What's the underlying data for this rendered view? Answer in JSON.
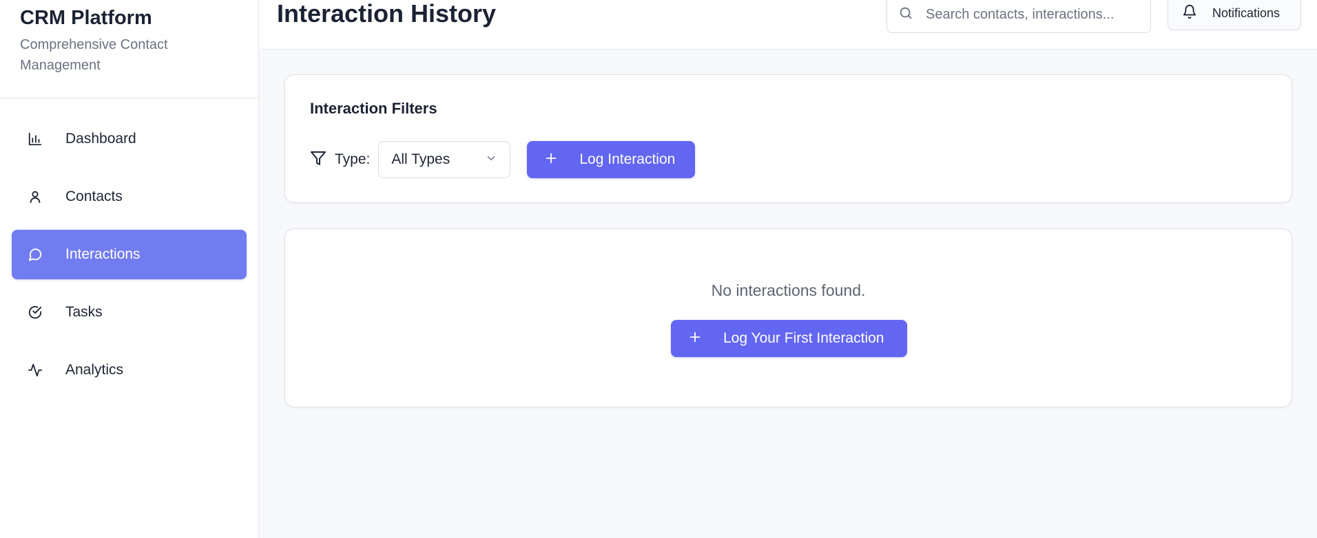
{
  "brand": {
    "title": "CRM Platform",
    "subtitle": "Comprehensive Contact Management"
  },
  "sidebar": {
    "items": [
      {
        "label": "Dashboard",
        "icon": "bar-chart-icon",
        "active": false
      },
      {
        "label": "Contacts",
        "icon": "user-icon",
        "active": false
      },
      {
        "label": "Interactions",
        "icon": "message-circle-icon",
        "active": true
      },
      {
        "label": "Tasks",
        "icon": "check-circle-icon",
        "active": false
      },
      {
        "label": "Analytics",
        "icon": "activity-icon",
        "active": false
      }
    ]
  },
  "header": {
    "title": "Interaction History",
    "search_placeholder": "Search contacts, interactions...",
    "notifications_label": "Notifications"
  },
  "filters": {
    "title": "Interaction Filters",
    "type_label": "Type:",
    "type_value": "All Types",
    "log_button": "Log Interaction"
  },
  "empty_state": {
    "message": "No interactions found.",
    "button": "Log Your First Interaction"
  },
  "colors": {
    "accent": "#6366f1",
    "active_nav": "#727cf1",
    "background": "#f8f9fb"
  }
}
